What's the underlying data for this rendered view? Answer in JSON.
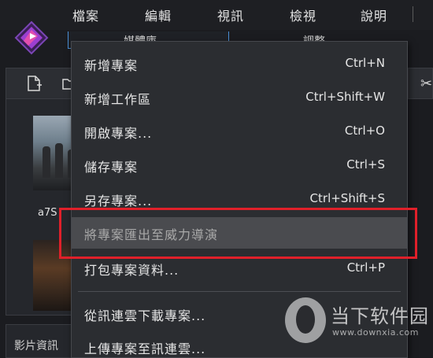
{
  "menubar": {
    "items": [
      "檔案",
      "編輯",
      "視訊",
      "檢視",
      "說明"
    ]
  },
  "tabs": {
    "library": "媒體庫",
    "adjust": "調整"
  },
  "library": {
    "thumb_caption": "a7S",
    "info_label": "影片資訊"
  },
  "file_menu": {
    "items": [
      {
        "label": "新增專案",
        "shortcut": "Ctrl+N"
      },
      {
        "label": "新增工作區",
        "shortcut": "Ctrl+Shift+W"
      },
      {
        "label": "開啟專案...",
        "shortcut": "Ctrl+O"
      },
      {
        "label": "儲存專案",
        "shortcut": "Ctrl+S"
      },
      {
        "label": "另存專案...",
        "shortcut": "Ctrl+Shift+S"
      },
      {
        "label": "將專案匯出至威力導演",
        "shortcut": ""
      },
      {
        "label": "打包專案資料...",
        "shortcut": "Ctrl+P"
      },
      {
        "label": "從訊連雲下載專案...",
        "shortcut": ""
      },
      {
        "label": "上傳專案至訊連雲...",
        "shortcut": ""
      }
    ]
  },
  "watermark": {
    "title": "当下软件园",
    "url": "www.downxia.com"
  },
  "colors": {
    "accent_blue": "#4a8fd6",
    "highlight_red": "#e0202a",
    "logo_purple": "#8a3fc4"
  }
}
